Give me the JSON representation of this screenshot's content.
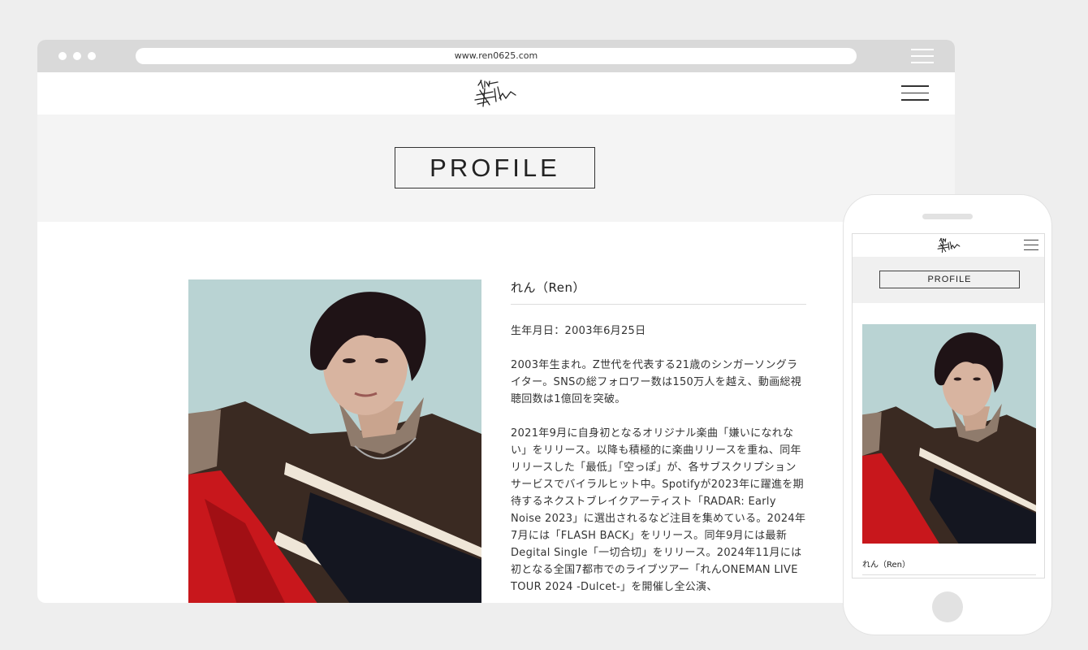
{
  "browser": {
    "url": "www.ren0625.com"
  },
  "site": {
    "logo_alt": "Ren"
  },
  "hero": {
    "title": "PROFILE"
  },
  "profile": {
    "name": "れん（Ren）",
    "birthdate": "生年月日：2003年6月25日",
    "paragraph1": "2003年生まれ。Z世代を代表する21歳のシンガーソングライター。SNSの総フォロワー数は150万人を越え、動画総視聴回数は1億回を突破。",
    "paragraph2": "2021年9月に自身初となるオリジナル楽曲「嫌いになれない」をリリース。以降も積極的に楽曲リリースを重ね、同年リリースした「最低」「空っぽ」が、各サブスクリプションサービスでバイラルヒット中。Spotifyが2023年に躍進を期待するネクストブレイクアーティスト「RADAR: Early Noise 2023」に選出されるなど注目を集めている。2024年7月には「FLASH BACK」をリリース。同年9月には最新Degital Single「一切合切」をリリース。2024年11月には初となる全国7都市でのライブツアー「れんONEMAN LIVE TOUR 2024 -Dulcet-」を開催し全公演、"
  },
  "mobile": {
    "title": "PROFILE",
    "name": "れん（Ren）"
  },
  "colors": {
    "page_bg": "#eeeeee",
    "chrome": "#d9d9d9",
    "hero_bg": "#f4f4f4",
    "photo_bg": "#b9d3d3",
    "sweater": "#3a2a22",
    "red_cloth": "#c8171c"
  }
}
